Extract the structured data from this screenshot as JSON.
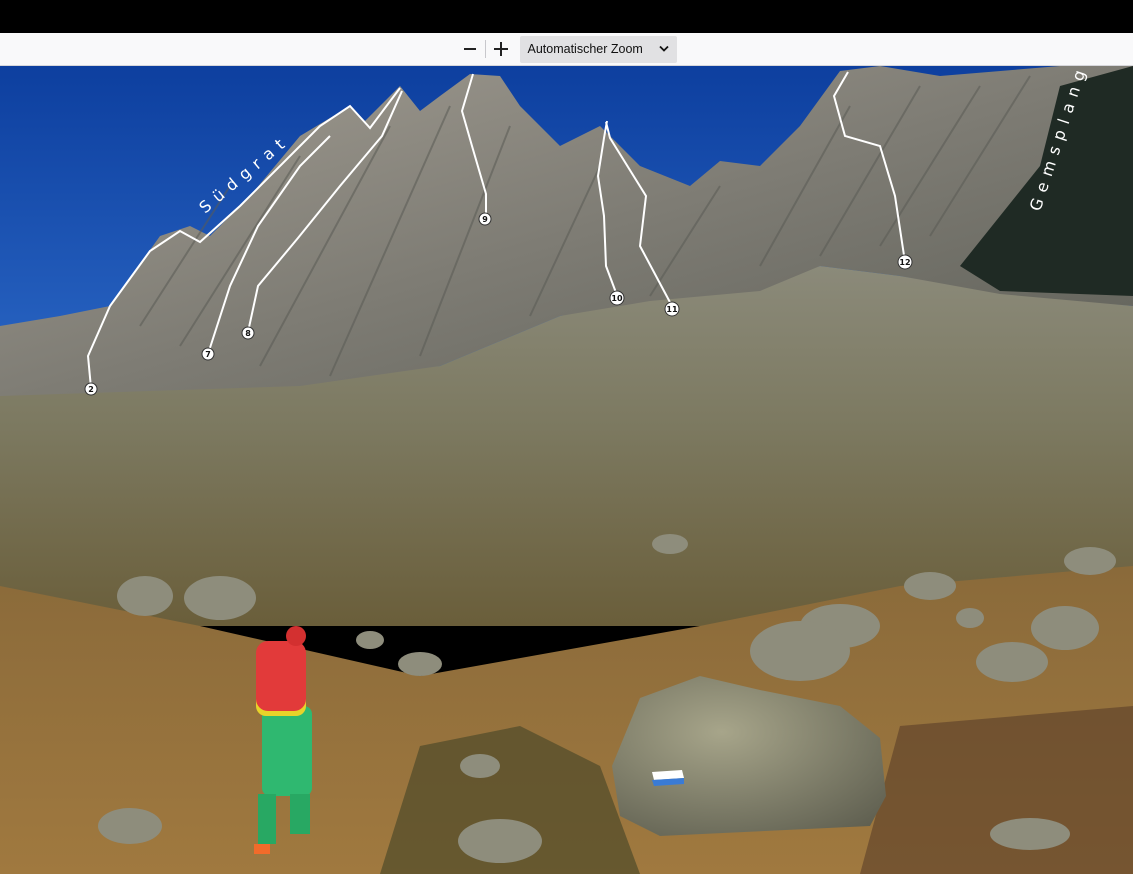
{
  "toolbar": {
    "zoom_out": "−",
    "zoom_in": "+",
    "zoom_level": "Automatischer Zoom"
  },
  "photo": {
    "labels": {
      "suedgrat": "Südgrat",
      "gemsplanggen": "Gemsplanggen"
    },
    "markers": [
      "2",
      "7",
      "8",
      "9",
      "10",
      "11",
      "12"
    ]
  },
  "colors": {
    "sky": "#1a4fb0",
    "rock": "#8d8d86",
    "meadow": "#9c7f4a",
    "jacket": "#e23a3a",
    "pants": "#2fb870"
  }
}
